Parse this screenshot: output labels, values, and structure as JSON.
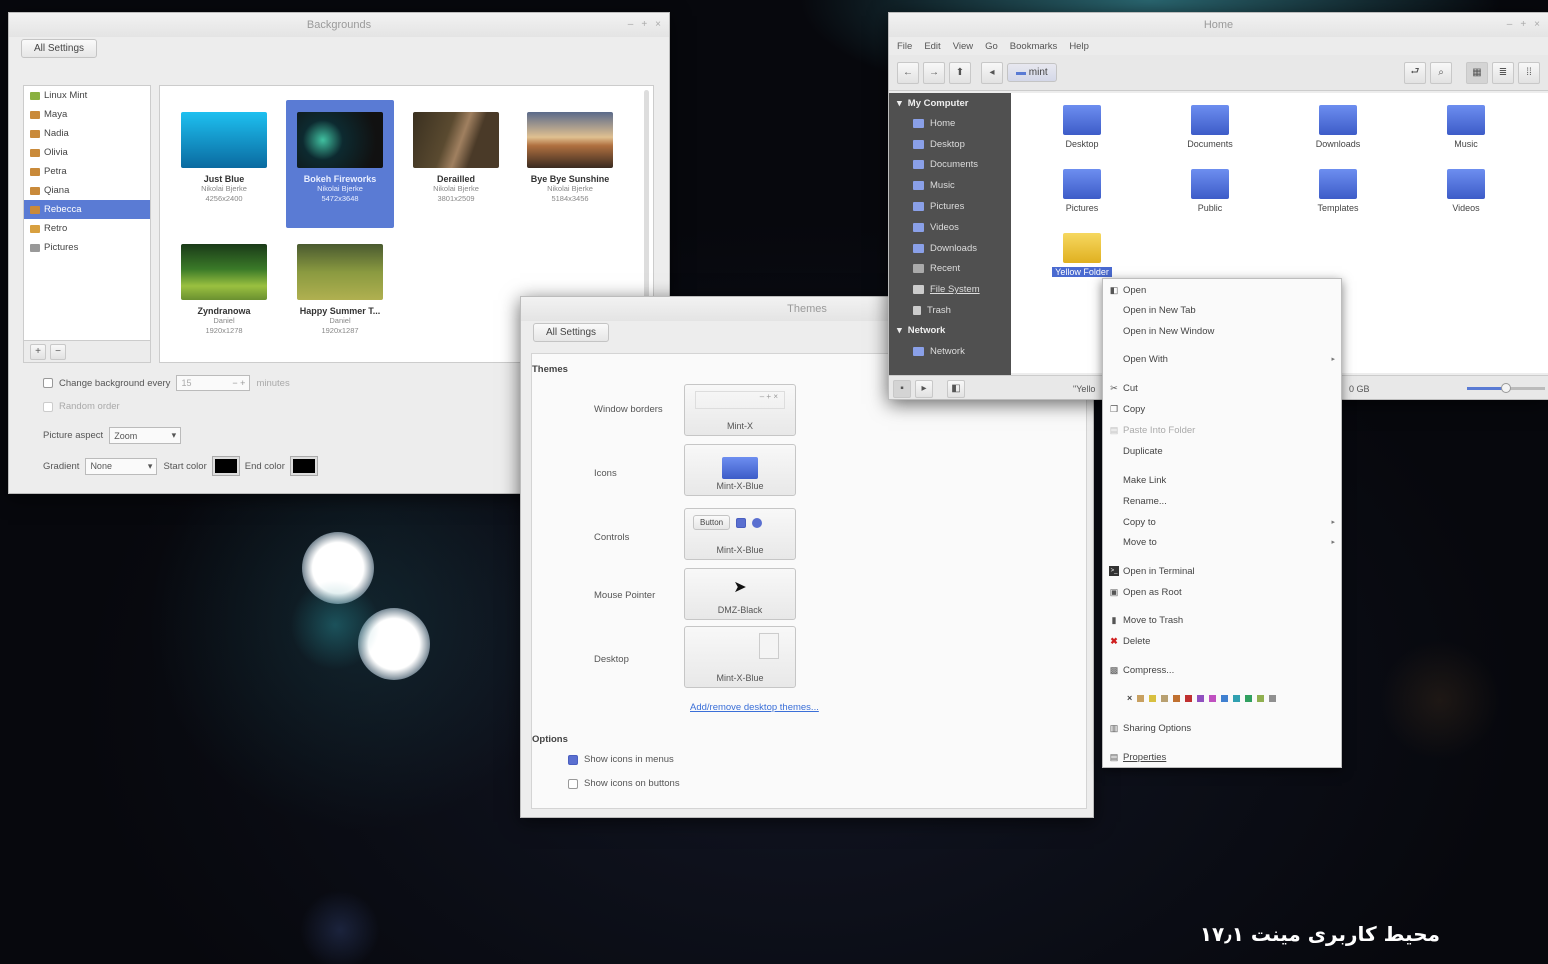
{
  "backgrounds": {
    "title": "Backgrounds",
    "all_settings": "All Settings",
    "sidebar": [
      "Linux Mint",
      "Maya",
      "Nadia",
      "Olivia",
      "Petra",
      "Qiana",
      "Rebecca",
      "Retro",
      "Pictures"
    ],
    "tiles": [
      {
        "name": "Just Blue",
        "author": "Nikolai Bjerke",
        "size": "4256x2400",
        "color1": "#1aa6d8",
        "color2": "#0a5a8a"
      },
      {
        "name": "Bokeh Fireworks",
        "author": "Nikolai Bjerke",
        "size": "5472x3648",
        "color1": "#0d2a30",
        "color2": "#1c1c1c"
      },
      {
        "name": "Derailled",
        "author": "Nikolai Bjerke",
        "size": "3801x2509",
        "color1": "#4a3a2a",
        "color2": "#8a6a4a"
      },
      {
        "name": "Bye Bye Sunshine",
        "author": "Nikolai Bjerke",
        "size": "5184x3456",
        "color1": "#d8b08a",
        "color2": "#3a2a20"
      },
      {
        "name": "Zyndranowa",
        "author": "Daniel",
        "size": "1920x1278",
        "color1": "#2a5a20",
        "color2": "#8ab040"
      },
      {
        "name": "Happy Summer T...",
        "author": "Daniel",
        "size": "1920x1287",
        "color1": "#8a9a40",
        "color2": "#5a7a20"
      }
    ],
    "change_every_label": "Change background every",
    "interval_value": "15",
    "interval_unit": "minutes",
    "random_order": "Random order",
    "picture_aspect_label": "Picture aspect",
    "picture_aspect_value": "Zoom",
    "gradient_label": "Gradient",
    "gradient_value": "None",
    "start_color_label": "Start color",
    "end_color_label": "End color"
  },
  "themes": {
    "title": "Themes",
    "all_settings": "All Settings",
    "section_themes": "Themes",
    "rows": [
      {
        "label": "Window borders",
        "value": "Mint-X"
      },
      {
        "label": "Icons",
        "value": "Mint-X-Blue"
      },
      {
        "label": "Controls",
        "value": "Mint-X-Blue"
      },
      {
        "label": "Mouse Pointer",
        "value": "DMZ-Black"
      },
      {
        "label": "Desktop",
        "value": "Mint-X-Blue"
      }
    ],
    "controls_button": "Button",
    "add_link": "Add/remove desktop themes...",
    "section_options": "Options",
    "opt_menus": "Show icons in menus",
    "opt_buttons": "Show icons on buttons"
  },
  "files": {
    "title": "Home",
    "menu": [
      "File",
      "Edit",
      "View",
      "Go",
      "Bookmarks",
      "Help"
    ],
    "path_button": "mint",
    "places_header": "My Computer",
    "places": [
      "Home",
      "Desktop",
      "Documents",
      "Music",
      "Pictures",
      "Videos",
      "Downloads",
      "Recent",
      "File System",
      "Trash"
    ],
    "network_header": "Network",
    "network_item": "Network",
    "icons": [
      "Desktop",
      "Documents",
      "Downloads",
      "Music",
      "Pictures",
      "Public",
      "Templates",
      "Videos"
    ],
    "selected_folder": "Yellow Folder",
    "status_text": "\"Yello",
    "status_free": "0 GB"
  },
  "context_menu": {
    "items": [
      {
        "label": "Open",
        "icon": "open-icon"
      },
      {
        "label": "Open in New Tab"
      },
      {
        "label": "Open in New Window"
      },
      {
        "label": "Open With",
        "submenu": true
      },
      {
        "label": "Cut",
        "icon": "cut-icon"
      },
      {
        "label": "Copy",
        "icon": "copy-icon"
      },
      {
        "label": "Paste Into Folder",
        "icon": "paste-icon",
        "disabled": true
      },
      {
        "label": "Duplicate"
      },
      {
        "label": "Make Link"
      },
      {
        "label": "Rename..."
      },
      {
        "label": "Copy to",
        "submenu": true
      },
      {
        "label": "Move to",
        "submenu": true
      },
      {
        "label": "Open in Terminal",
        "icon": "terminal-icon"
      },
      {
        "label": "Open as Root",
        "icon": "root-icon"
      },
      {
        "label": "Move to Trash",
        "icon": "trash-icon"
      },
      {
        "label": "Delete",
        "icon": "delete-icon"
      },
      {
        "label": "Compress...",
        "icon": "compress-icon"
      },
      {
        "label": "Sharing Options",
        "icon": "share-icon"
      },
      {
        "label": "Properties",
        "icon": "properties-icon"
      }
    ],
    "folder_colors": [
      "#c8a060",
      "#d8c040",
      "#b8a070",
      "#c07030",
      "#c03030",
      "#9050c0",
      "#c050c0",
      "#4080d0",
      "#30a0b0",
      "#30a060",
      "#90b050",
      "#909090"
    ]
  },
  "caption": "محیط کاربری مینت ۱۷٫۱"
}
